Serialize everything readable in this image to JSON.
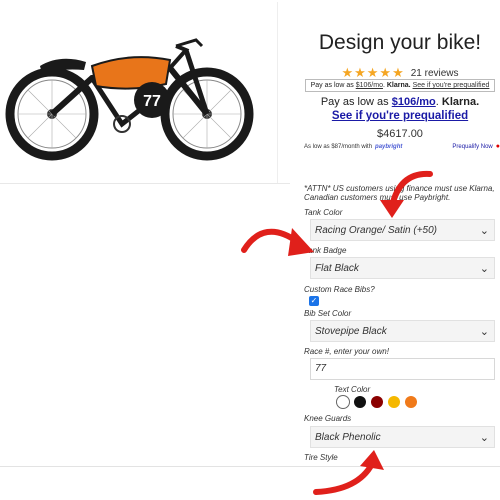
{
  "product": {
    "title": "Design your bike!",
    "rating_stars": "★★★★★",
    "reviews": "21 reviews",
    "price": "$4617.00"
  },
  "klarna_small": {
    "prefix": "Pay as low as ",
    "amount": "$106/mo",
    "brand": "Klarna.",
    "link": "See if you're prequalified"
  },
  "klarna_big": {
    "prefix": "Pay as low as ",
    "amount": "$106/mo",
    "brand": "Klarna.",
    "link": "See if you're prequalified"
  },
  "paybright": {
    "text": "As low as $87/month with",
    "logo": "paybright",
    "link": "Prequalify Now"
  },
  "notice": "*ATTN* US customers using finance must use Klarna, Canadian customers must use Paybright.",
  "options": {
    "tank_color": {
      "label": "Tank Color",
      "value": "Racing Orange/ Satin (+50)"
    },
    "tank_badge": {
      "label": "Tank Badge",
      "value": "Flat Black"
    },
    "race_bibs": {
      "label": "Custom Race Bibs?",
      "checked": true
    },
    "bib_set_color": {
      "label": "Bib Set Color",
      "value": "Stovepipe Black"
    },
    "race_number": {
      "label": "Race #, enter your own!",
      "value": "77"
    },
    "text_color": {
      "label": "Text Color",
      "swatches": [
        "#ffffff",
        "#111111",
        "#8b0000",
        "#f5b800",
        "#f07a1a"
      ]
    },
    "knee_guards": {
      "label": "Knee Guards",
      "value": "Black Phenolic"
    },
    "tire_style": {
      "label": "Tire Style"
    }
  },
  "bike_badge_number": "77",
  "colors": {
    "accent_orange": "#e8751a",
    "arrow_red": "#e0201b",
    "link_blue": "#1a1aa6",
    "star": "#f5a623"
  }
}
